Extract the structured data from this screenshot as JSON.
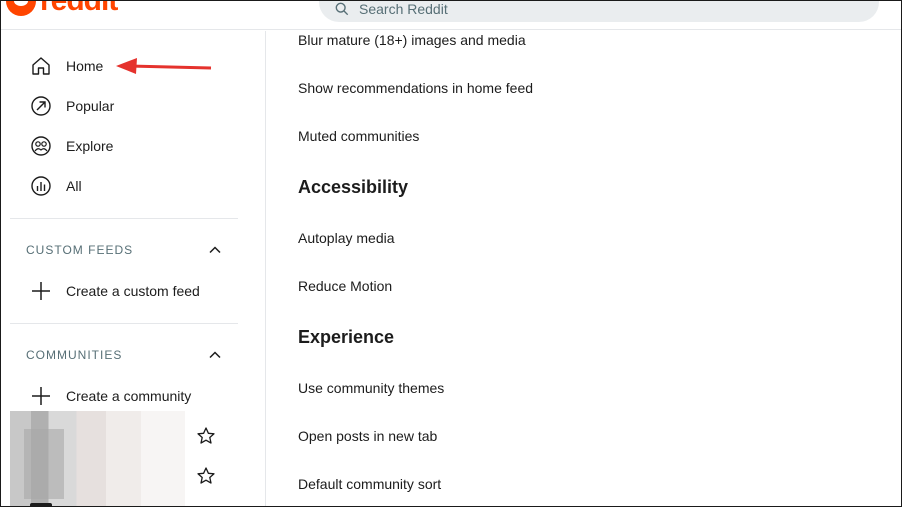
{
  "header": {
    "logo_text": "reddit",
    "search_placeholder": "Search Reddit"
  },
  "sidebar": {
    "nav": [
      {
        "label": "Home",
        "icon": "home-icon"
      },
      {
        "label": "Popular",
        "icon": "popular-arrow-icon"
      },
      {
        "label": "Explore",
        "icon": "explore-icon"
      },
      {
        "label": "All",
        "icon": "all-chart-icon"
      }
    ],
    "custom_feeds": {
      "title": "CUSTOM FEEDS",
      "create_label": "Create a custom feed"
    },
    "communities": {
      "title": "COMMUNITIES",
      "create_label": "Create a community"
    }
  },
  "annotation": {
    "arrow_color": "#e5322d"
  },
  "settings": {
    "items_top": [
      "Blur mature (18+) images and media",
      "Show recommendations in home feed",
      "Muted communities"
    ],
    "accessibility_title": "Accessibility",
    "accessibility_items": [
      "Autoplay media",
      "Reduce Motion"
    ],
    "experience_title": "Experience",
    "experience_items": [
      "Use community themes",
      "Open posts in new tab",
      "Default community sort"
    ]
  },
  "colors": {
    "brand": "#ff4500",
    "text": "#1c1c1c",
    "muted": "#576f76",
    "divider": "#e5e7ea"
  }
}
